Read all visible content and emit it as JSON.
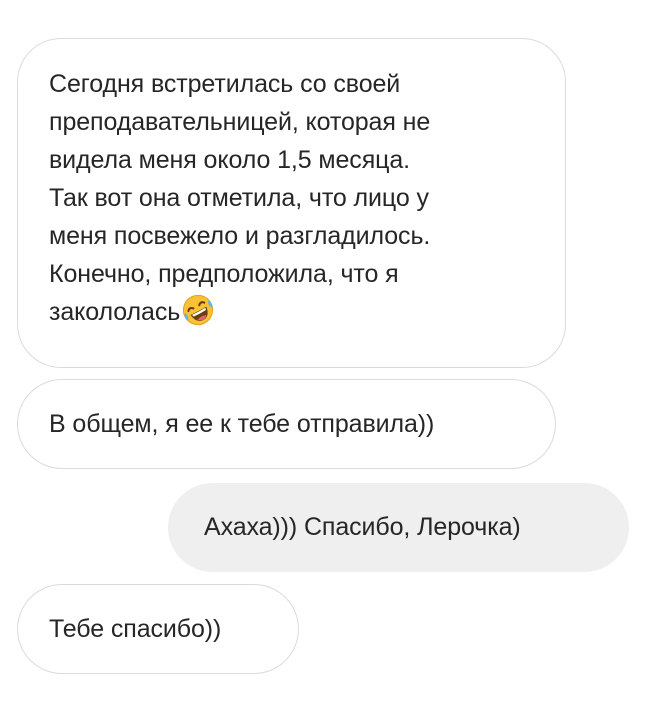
{
  "messages": [
    {
      "sender": "incoming",
      "lines": [
        "Сегодня встретилась со своей",
        "преподавательницей, которая не",
        "видела меня около 1,5 месяца.",
        "Так вот она отметила, что лицо у",
        "меня посвежело и разгладилось.",
        "Конечно, предположила, что я",
        "закололась"
      ],
      "trailing_icon": "rolling-on-floor-laughing-emoji-icon"
    },
    {
      "sender": "incoming",
      "text": "В общем, я ее к тебе отправила))"
    },
    {
      "sender": "outgoing",
      "text": "Ахаха))) Спасибо, Лерочка)"
    },
    {
      "sender": "incoming",
      "text": "Тебе спасибо))"
    }
  ],
  "colors": {
    "incoming_bubble_bg": "#ffffff",
    "incoming_bubble_border": "#dbdbdb",
    "outgoing_bubble_bg": "#efefef",
    "text": "#262626"
  }
}
